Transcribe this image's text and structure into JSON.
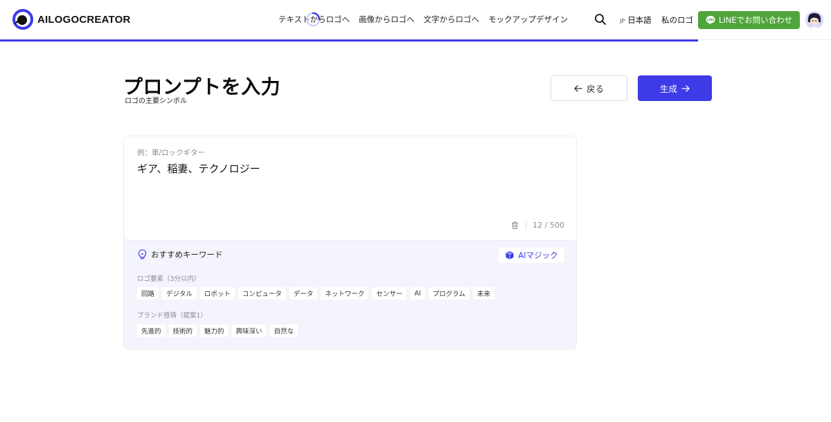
{
  "brand": {
    "name": "AILOGOCREATOR"
  },
  "nav": {
    "items": [
      "テキストからロゴへ",
      "画像からロゴへ",
      "文字からロゴへ",
      "モックアップデザイン"
    ]
  },
  "header": {
    "lang_code": "JP",
    "lang_label": "日本語",
    "my_logo": "私のロゴ",
    "line_button": "LINEでお問い合わせ"
  },
  "progress": {
    "fraction": 0.84
  },
  "page": {
    "title": "プロンプトを入力",
    "subtitle": "ロゴの主要シンボル",
    "back_label": "戻る",
    "generate_label": "生成"
  },
  "prompt": {
    "placeholder": "例：車/ロックギター",
    "value": "ギア、稲妻、テクノロジー",
    "count": "12 / 500"
  },
  "keywords": {
    "heading": "おすすめキーワード",
    "magic_label": "AIマジック",
    "sections": [
      {
        "label": "ロゴ要素（3分以内）",
        "chips": [
          "回路",
          "デジタル",
          "ロボット",
          "コンピュータ",
          "データ",
          "ネットワーク",
          "センサー",
          "AI",
          "プログラム",
          "未来"
        ]
      },
      {
        "label": "ブランド感情（提案1）",
        "chips": [
          "先進的",
          "技術的",
          "魅力的",
          "興味深い",
          "自然な"
        ]
      }
    ]
  },
  "colors": {
    "accent": "#3d3ae8",
    "line_green": "#4fa43b",
    "card_bg": "#f4f4fc"
  },
  "icons": [
    "search-icon",
    "arrow-left-icon",
    "arrow-right-icon",
    "trash-icon",
    "bulb-icon",
    "magic-cube-icon",
    "line-chat-icon",
    "loading-spinner-icon"
  ]
}
